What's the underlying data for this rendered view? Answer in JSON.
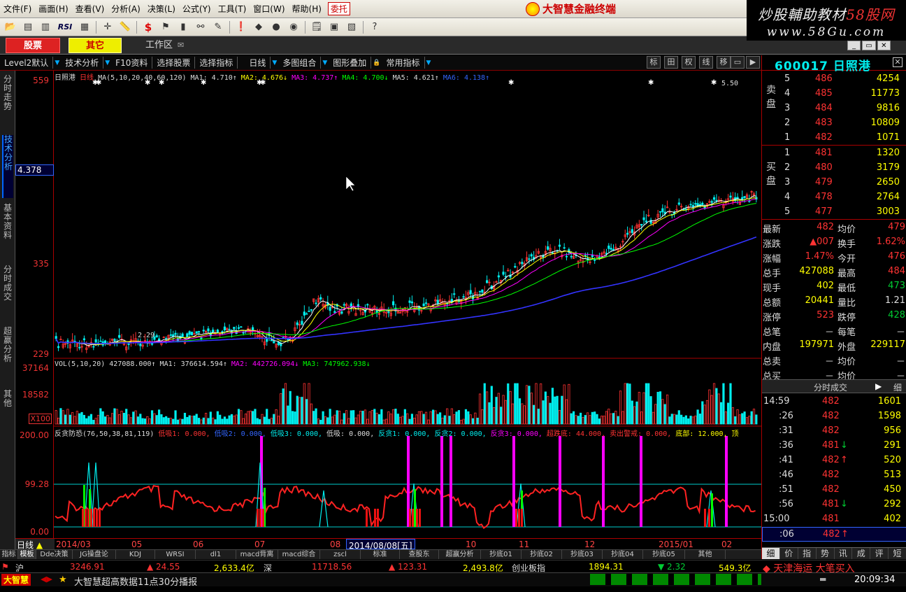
{
  "menu": {
    "items": [
      "文件(F)",
      "画面(H)",
      "查看(V)",
      "分析(A)",
      "决策(L)",
      "公式(Y)",
      "工具(T)",
      "窗口(W)",
      "帮助(H)"
    ],
    "entrust": "委托",
    "brand": "大智慧金融终端"
  },
  "watermark": {
    "line1a": "炒股輔助教材",
    "line1b": "58股网",
    "line2": "www.58Gu.com"
  },
  "tabs": {
    "stock": "股票",
    "other": "其它",
    "workspace": "工作区"
  },
  "sub": {
    "level2": "Level2默认",
    "tech": "技术分析",
    "f10": "F10资料",
    "select_stock": "选择股票",
    "select_index": "选择指标",
    "period": "日线",
    "multi": "多图组合",
    "overlay": "图形叠加",
    "common": "常用指标",
    "right_btns": [
      "标",
      "田",
      "权",
      "线",
      "移",
      "▭",
      "▶"
    ]
  },
  "side": {
    "items": [
      "分时走势",
      "技术分析",
      "基本资料",
      "分时成交",
      "超赢分析",
      "其他"
    ]
  },
  "axis": {
    "price_top": "559",
    "price_cur": "4.378",
    "price_mid": "335",
    "price_low": "229",
    "vol_top": "37164",
    "vol_mid": "18582",
    "vol_unit": "X100",
    "ind_top": "200.00",
    "ind_mid": "99.28",
    "ind_low": "0.00"
  },
  "chart_data": {
    "type": "candlestick",
    "title": "日照港",
    "period": "日线",
    "ma_params": "MA(5,10,20,40,60,120)",
    "ma1": "MA1: 4.710↑",
    "ma2": "MA2: 4.676↓",
    "ma3": "MA3: 4.737↑",
    "ma4": "MA4: 4.700↓",
    "ma5": "MA5: 4.621↑",
    "ma6": "MA6: 4.138↑",
    "hi_mark": "5.50",
    "lo_mark": "2.29",
    "vol_title": "VOL(5,10,20)",
    "vol_val": "427088.000↑",
    "vol_ma1": "MA1: 376614.594↑",
    "vol_ma2": "MA2: 442726.094↓",
    "vol_ma3": "MA3: 747962.938↓",
    "ind_title": "反贪防恐(76,50,38,81,119)",
    "ind_items": [
      "低吸1: 0.000,",
      "低吸2: 0.000,",
      "低吸3: 0.000,",
      "低吸: 0.000,",
      "反贪1: 0.000,",
      "反贪2: 0.000,",
      "反贪3: 0.000,",
      "超跌底: 44.000,",
      "卖出警戒: 0.000,",
      "底部: 12.000,",
      "顶"
    ],
    "x_labels": [
      "2014/03",
      "05",
      "06",
      "07",
      "08",
      "10",
      "11",
      "12",
      "2015/01",
      "02"
    ],
    "day_label": "日线",
    "selected_date": "2014/08/08[五]"
  },
  "btabs": [
    "指标",
    "模板",
    "Dde决策",
    "JG操盘论",
    "KDJ",
    "WRSI",
    "dl1",
    "macd背离",
    "macd综合",
    "zscl",
    "标准",
    "查股东",
    "超赢分析",
    "抄底01",
    "抄底02",
    "抄底03",
    "抄底04",
    "抄底05",
    "其他"
  ],
  "index": {
    "sh": "沪",
    "sh_val": "3246.91",
    "sh_chg": "▲ 24.55",
    "sh_amt": "2,633.4亿",
    "sz": "深",
    "sz_val": "11718.56",
    "sz_chg": "▲ 123.31",
    "sz_amt": "2,493.8亿",
    "cy": "创业板指",
    "cy_val": "1894.31",
    "cy_chg": "▼ 2.32",
    "cy_amt": "549.3亿",
    "news": "◆ 天津海运 大笔买入"
  },
  "status": {
    "app": "大智慧",
    "msg": "大智慧超高数据11点30分播报",
    "time": "20:09:34"
  },
  "quote": {
    "code": "600017",
    "name": "日照港",
    "ask": [
      {
        "lv": "5",
        "p": "486",
        "v": "4254"
      },
      {
        "lv": "4",
        "p": "485",
        "v": "11773"
      },
      {
        "lv": "3",
        "p": "484",
        "v": "9816"
      },
      {
        "lv": "2",
        "p": "483",
        "v": "10809"
      },
      {
        "lv": "1",
        "p": "482",
        "v": "1071"
      }
    ],
    "bid": [
      {
        "lv": "1",
        "p": "481",
        "v": "1320"
      },
      {
        "lv": "2",
        "p": "480",
        "v": "3179"
      },
      {
        "lv": "3",
        "p": "479",
        "v": "2650"
      },
      {
        "lv": "4",
        "p": "478",
        "v": "2764"
      },
      {
        "lv": "5",
        "p": "477",
        "v": "3003"
      }
    ],
    "ask_label": "卖盘",
    "bid_label": "买盘",
    "stats": [
      [
        "最新",
        "482",
        "均价",
        "479"
      ],
      [
        "涨跌",
        "▲007",
        "换手",
        "1.62%"
      ],
      [
        "涨幅",
        "1.47%",
        "今开",
        "476"
      ],
      [
        "总手",
        "427088",
        "最高",
        "484"
      ],
      [
        "现手",
        "402",
        "最低",
        "473"
      ],
      [
        "总额",
        "20441",
        "量比",
        "1.21"
      ],
      [
        "涨停",
        "523",
        "跌停",
        "428"
      ],
      [
        "总笔",
        "－",
        "每笔",
        "－"
      ],
      [
        "内盘",
        "197971",
        "外盘",
        "229117"
      ],
      [
        "总卖",
        "－",
        "均价",
        "－"
      ],
      [
        "总买",
        "－",
        "均价",
        "－"
      ]
    ],
    "ts_title": "分时成交",
    "ts_tab": "细",
    "ticks": [
      [
        "14:59",
        "482",
        "1601",
        ""
      ],
      [
        ":26",
        "482",
        "1598",
        ""
      ],
      [
        ":31",
        "482",
        "956",
        ""
      ],
      [
        ":36",
        "481",
        "291",
        "↓"
      ],
      [
        ":41",
        "482",
        "520",
        "↑"
      ],
      [
        ":46",
        "482",
        "513",
        ""
      ],
      [
        ":51",
        "482",
        "450",
        ""
      ],
      [
        ":56",
        "481",
        "292",
        "↓"
      ],
      [
        "15:00",
        "481",
        "402",
        ""
      ],
      [
        ":06",
        "482",
        "",
        "↑"
      ]
    ],
    "tabs": [
      "细",
      "价",
      "指",
      "势",
      "讯",
      "成",
      "评",
      "短"
    ]
  }
}
